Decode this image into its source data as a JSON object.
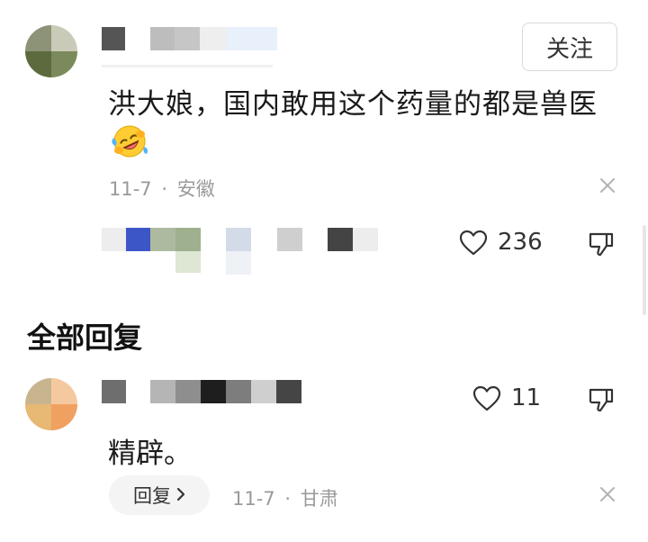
{
  "main_comment": {
    "follow_label": "关注",
    "text": "洪大娘，国内敢用这个药量的都是兽医",
    "emoji": "rolling-on-floor-laughing-emoji",
    "date": "11-7",
    "separator": "·",
    "location": "安徽",
    "like_count": "236"
  },
  "section": {
    "title": "全部回复"
  },
  "reply": {
    "text": "精辟。",
    "like_count": "11",
    "reply_label": "回复",
    "date": "11-7",
    "separator": "·",
    "location": "甘肃"
  },
  "colors": {
    "accent_blue": "#3d56c7",
    "meta_gray": "#9a9a9a"
  }
}
